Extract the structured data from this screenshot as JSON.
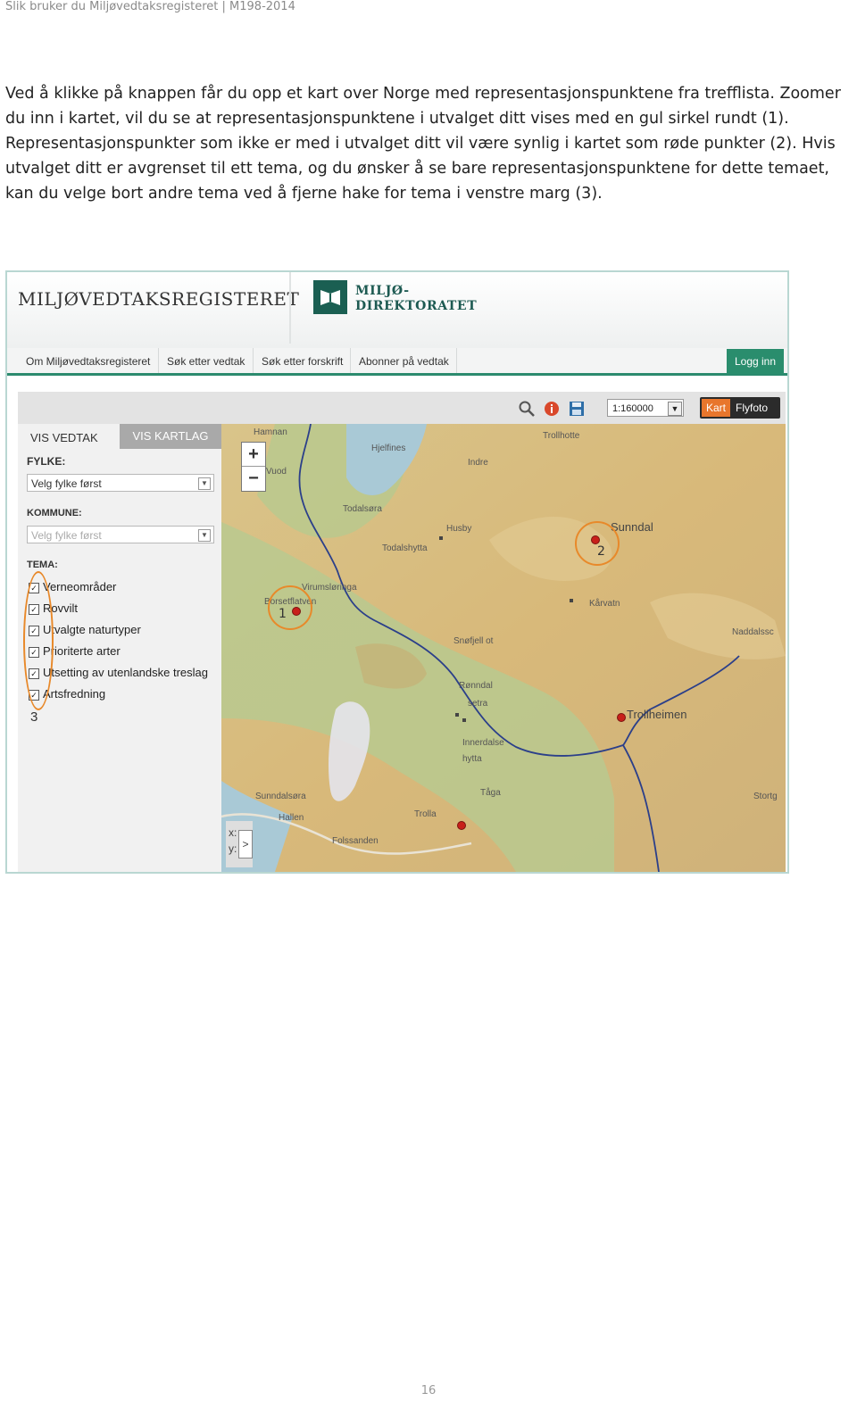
{
  "document": {
    "running_header": "Slik bruker du Miljøvedtaksregisteret  |  M198-2014",
    "intro_text": "Ved å klikke på knappen får du opp et kart over Norge med  representasjonspunktene fra trefflista. Zoomer du inn i kartet, vil du se at representasjonspunktene i utvalget ditt vises med en gul sirkel rundt (1). Representasjonspunkter som ikke er med i utvalget ditt vil være synlig i kartet som røde punkter (2). Hvis utvalget ditt er avgrenset til ett tema, og du ønsker å se bare representasjonspunktene for dette temaet, kan du velge bort andre tema ved å fjerne hake for tema i venstre marg (3).",
    "page_number": "16"
  },
  "screenshot": {
    "header": {
      "title": "MILJØVEDTAKSREGISTERET",
      "logo_line1": "MILJØ-",
      "logo_line2": "DIREKTORATET"
    },
    "nav": {
      "items": [
        "Om Miljøvedtaksregisteret",
        "Søk etter vedtak",
        "Søk etter forskrift",
        "Abonner på vedtak"
      ],
      "login": "Logg inn"
    },
    "toolbar": {
      "scale": "1:160000",
      "map_type_active": "Kart",
      "map_type_other": "Flyfoto"
    },
    "sidebar": {
      "tab_active": "VIS VEDTAK",
      "tab_other": "VIS KARTLAG",
      "fylke_label": "FYLKE:",
      "fylke_value": "Velg fylke først",
      "kommune_label": "KOMMUNE:",
      "kommune_value": "Velg fylke først",
      "tema_label": "TEMA:",
      "tema_items": [
        "Verneområder",
        "Rovvilt",
        "Utvalgte naturtyper",
        "Prioriterte arter",
        "Utsetting av utenlandske treslag",
        "Artsfredning"
      ],
      "annotation_3": "3"
    },
    "map": {
      "coord_x": "x:",
      "coord_y": "y:",
      "coord_button": ">",
      "annotation_1": "1",
      "annotation_2": "2",
      "places": [
        "Hamnan",
        "Hjelfines",
        "Vuod",
        "Indre",
        "Trollhotte",
        "Todalsøra",
        "Husby",
        "Sunndal",
        "Todalshytta",
        "Virumsløringa",
        "Borsetflatven",
        "Kårvatn",
        "Snøfjell ot",
        "Naddalssc",
        "Rønndal",
        "setra",
        "Trollheimen",
        "Innerdalse",
        "hytta",
        "Sunndalsøra",
        "Hallen",
        "Tåga",
        "Trolla",
        "Folssanden",
        "Stortg"
      ]
    },
    "colors": {
      "accent_green": "#2a8d6d",
      "brand_dark_green": "#1a5f52",
      "highlight_orange": "#e8892a",
      "point_red": "#c8201a"
    }
  }
}
